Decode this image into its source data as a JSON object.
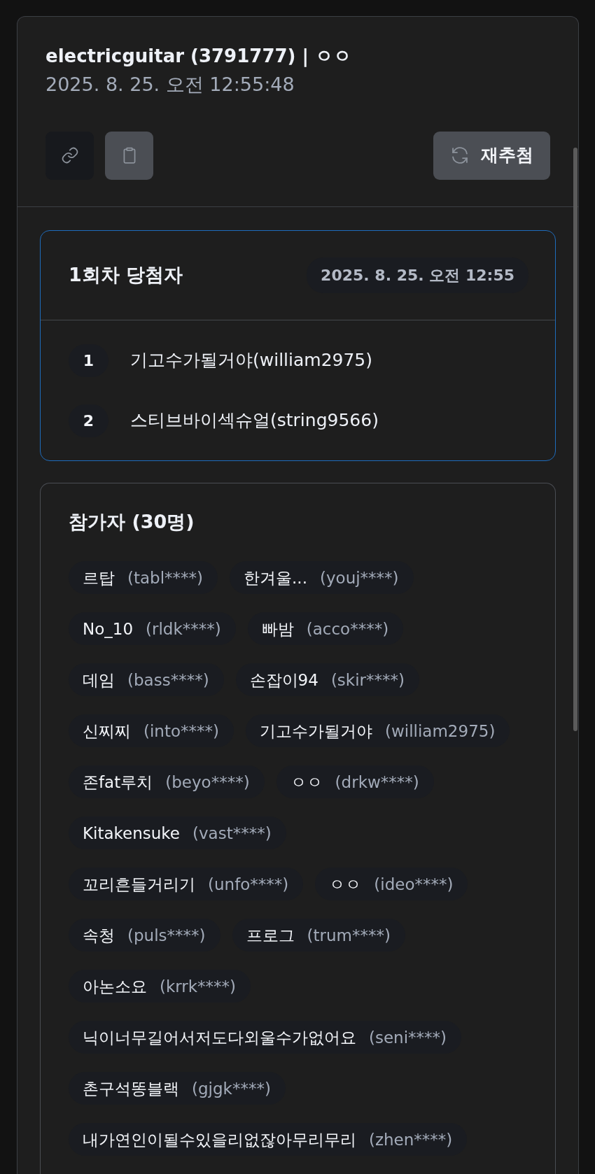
{
  "header": {
    "title": "electricguitar (3791777) | ㅇㅇ",
    "timestamp": "2025. 8. 25. 오전 12:55:48"
  },
  "toolbar": [
    {
      "kind": "link"
    },
    {
      "kind": "copy"
    },
    {
      "kind": "redraw",
      "label": "재추첨"
    }
  ],
  "draw": {
    "title": "1회차 당첨자",
    "time": "2025. 8. 25. 오전 12:55",
    "winners": [
      {
        "rank": "1",
        "name": "기고수가될거야(william2975)"
      },
      {
        "rank": "2",
        "name": "스티브바이섹슈얼(string9566)"
      }
    ]
  },
  "participants": {
    "title": "참가자 (30명)",
    "items": [
      {
        "nickname": "르탑",
        "user_id": "(tabl****)"
      },
      {
        "nickname": "한겨울...",
        "user_id": "(youj****)"
      },
      {
        "nickname": "No_10",
        "user_id": "(rldk****)"
      },
      {
        "nickname": "빠밤",
        "user_id": "(acco****)"
      },
      {
        "nickname": "데임",
        "user_id": "(bass****)"
      },
      {
        "nickname": "손잡이94",
        "user_id": "(skir****)"
      },
      {
        "nickname": "신찌찌",
        "user_id": "(into****)"
      },
      {
        "nickname": "기고수가될거야",
        "user_id": "(william2975)"
      },
      {
        "nickname": "존fat루치",
        "user_id": "(beyo****)"
      },
      {
        "nickname": "ㅇㅇ",
        "user_id": "(drkw****)"
      },
      {
        "nickname": "Kitakensuke",
        "user_id": "(vast****)"
      },
      {
        "nickname": "꼬리흔들거리기",
        "user_id": "(unfo****)"
      },
      {
        "nickname": "ㅇㅇ",
        "user_id": "(ideo****)"
      },
      {
        "nickname": "속청",
        "user_id": "(puls****)"
      },
      {
        "nickname": "프로그",
        "user_id": "(trum****)"
      },
      {
        "nickname": "아논소요",
        "user_id": "(krrk****)"
      },
      {
        "nickname": "닉이너무길어서저도다외울수가없어요",
        "user_id": "(seni****)"
      },
      {
        "nickname": "촌구석똥블랙",
        "user_id": "(gjgk****)"
      },
      {
        "nickname": "내가연인이될수있을리없잖아무리무리",
        "user_id": "(zhen****)"
      }
    ]
  }
}
